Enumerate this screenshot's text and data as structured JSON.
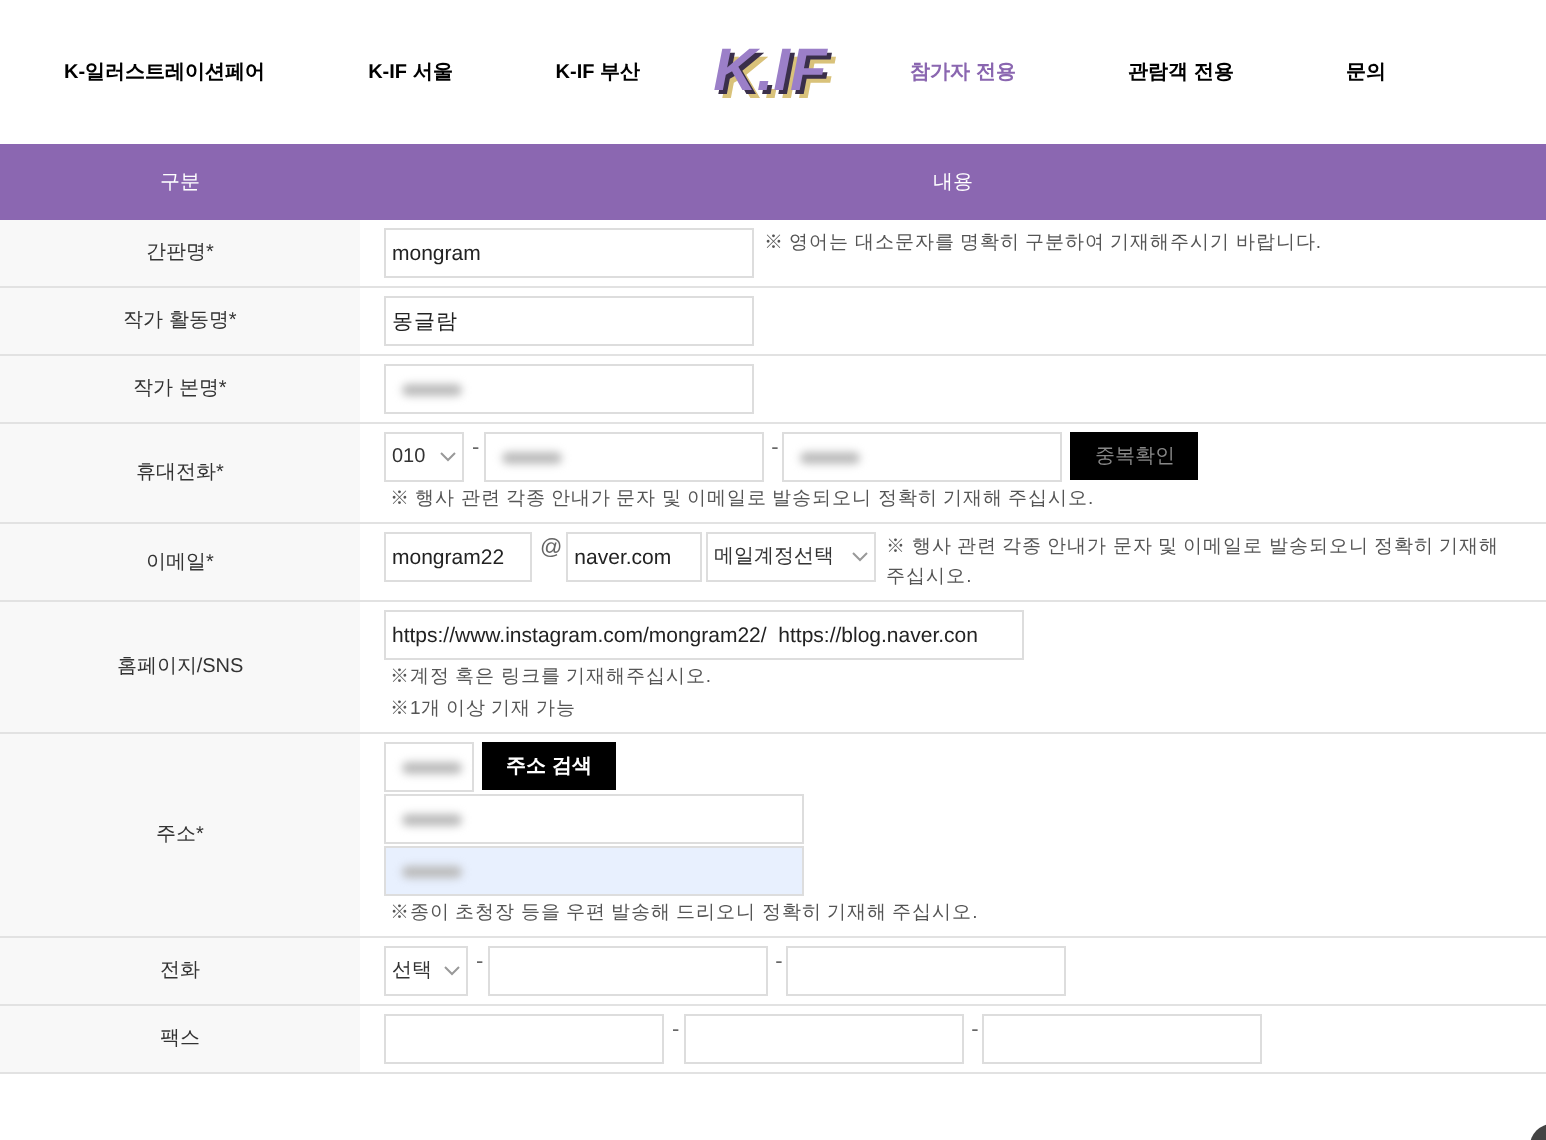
{
  "nav_left": [
    {
      "label": "K-일러스트레이션페어",
      "selected": false
    },
    {
      "label": "K-IF 서울",
      "selected": false
    },
    {
      "label": "K-IF 부산",
      "selected": false
    }
  ],
  "logo": "K.IF",
  "nav_right": [
    {
      "label": "참가자 전용",
      "selected": true
    },
    {
      "label": "관람객 전용",
      "selected": false
    },
    {
      "label": "문의",
      "selected": false
    }
  ],
  "table": {
    "columns": [
      "구분",
      "내용"
    ],
    "rows": [
      {
        "label": "간판명*",
        "lines": [
          [
            {
              "kind": "field",
              "value": "mongram"
            },
            {
              "kind": "note",
              "text": "※ 영어는 대소문자를 명확히 구분하여 기재해주시기 바랍니다."
            }
          ]
        ]
      },
      {
        "label": "작가 활동명*",
        "lines": [
          [
            {
              "kind": "field",
              "value": "몽글람"
            }
          ]
        ]
      },
      {
        "label": "작가 본명*",
        "lines": [
          [
            {
              "kind": "blurred",
              "autofilled": false
            }
          ]
        ]
      },
      {
        "label": "휴대전화*",
        "lines": [
          [
            {
              "kind": "select",
              "value": "010"
            },
            {
              "kind": "sep",
              "text": "-"
            },
            {
              "kind": "blurred",
              "autofilled": false
            },
            {
              "kind": "sep",
              "text": "-"
            },
            {
              "kind": "blurred",
              "autofilled": false
            },
            {
              "kind": "button",
              "text": "중복확인",
              "disabled": true
            }
          ],
          [
            {
              "kind": "note",
              "text": "※ 행사 관련 각종 안내가 문자 및 이메일로 발송되오니 정확히 기재해 주십시오."
            }
          ]
        ]
      },
      {
        "label": "이메일*",
        "lines": [
          [
            {
              "kind": "field",
              "value": "mongram22"
            },
            {
              "kind": "sep",
              "text": "@"
            },
            {
              "kind": "field",
              "value": "naver.com"
            },
            {
              "kind": "select",
              "value": "메일계정선택"
            },
            {
              "kind": "note",
              "text": "※ 행사 관련 각종 안내가 문자 및 이메일로 발송되오니 정확히 기재해 주십시오."
            }
          ]
        ]
      },
      {
        "label": "홈페이지/SNS",
        "lines": [
          [
            {
              "kind": "field",
              "value": "https://www.instagram.com/mongram22/  https://blog.naver.con"
            }
          ],
          [
            {
              "kind": "note",
              "text": "※계정 혹은 링크를 기재해주십시오."
            }
          ],
          [
            {
              "kind": "note",
              "text": "※1개 이상 기재 가능"
            }
          ]
        ]
      },
      {
        "label": "주소*",
        "lines": [
          [
            {
              "kind": "blurred",
              "autofilled": false
            },
            {
              "kind": "button",
              "text": "주소 검색",
              "disabled": false
            }
          ],
          [
            {
              "kind": "blurred",
              "autofilled": false
            }
          ],
          [
            {
              "kind": "blurred",
              "autofilled": true
            }
          ],
          [
            {
              "kind": "note",
              "text": "※종이 초청장 등을 우편 발송해 드리오니 정확히 기재해 주십시오."
            }
          ]
        ]
      },
      {
        "label": "전화",
        "lines": [
          [
            {
              "kind": "select",
              "value": "선택"
            },
            {
              "kind": "sep",
              "text": "-"
            },
            {
              "kind": "field"
            },
            {
              "kind": "sep",
              "text": "-"
            },
            {
              "kind": "field"
            }
          ]
        ]
      },
      {
        "label": "팩스",
        "lines": [
          [
            {
              "kind": "field"
            },
            {
              "kind": "sep",
              "text": "-"
            },
            {
              "kind": "field"
            },
            {
              "kind": "sep",
              "text": "-"
            },
            {
              "kind": "field"
            }
          ]
        ]
      }
    ]
  }
}
